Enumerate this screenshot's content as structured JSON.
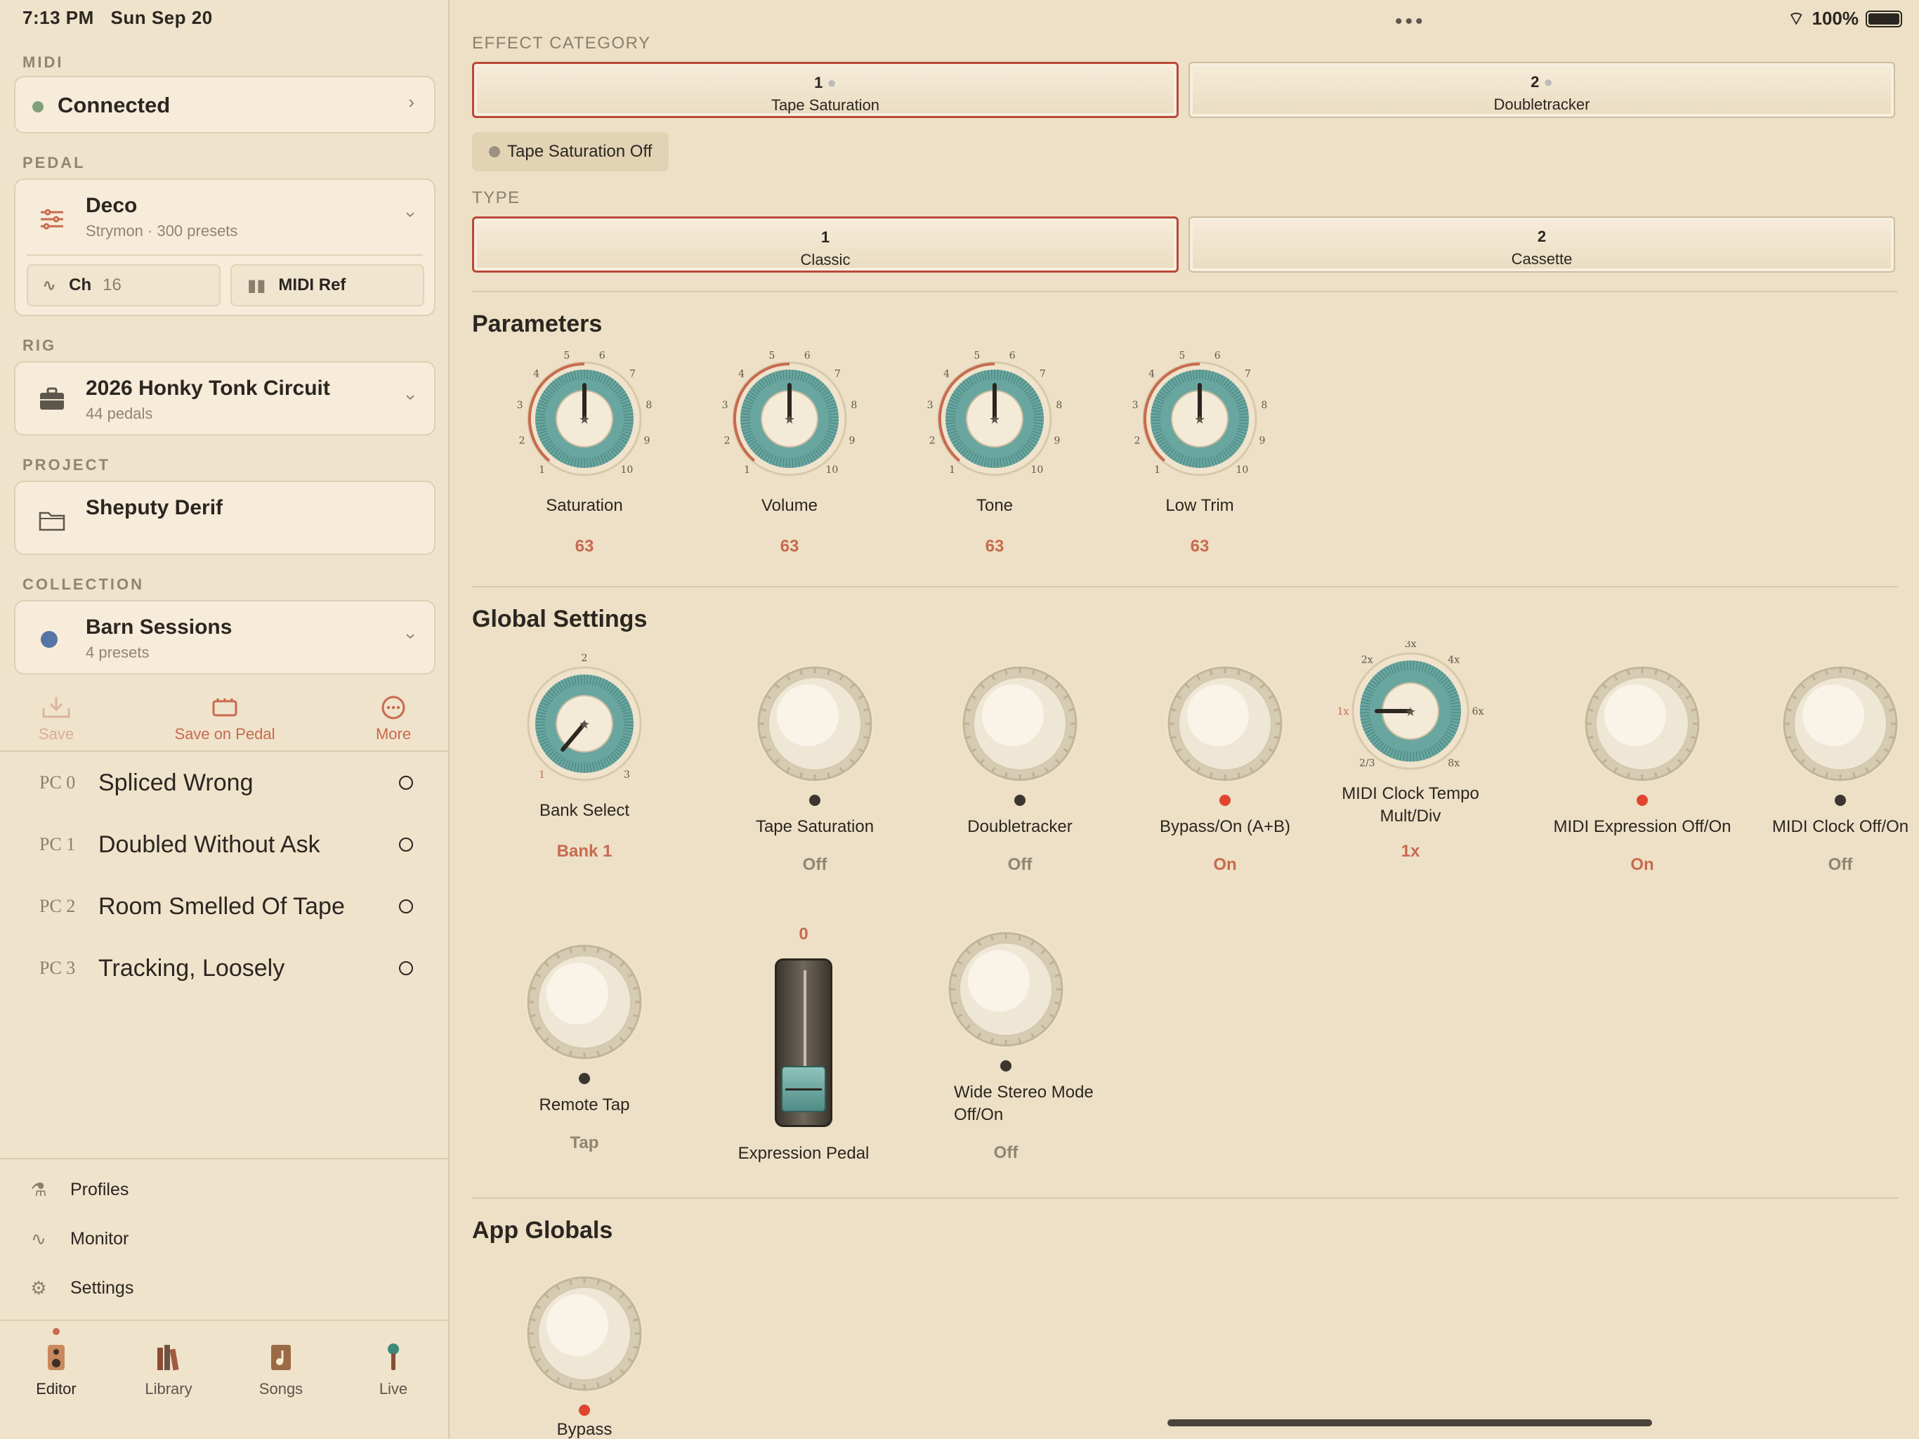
{
  "status": {
    "time": "7:13 PM",
    "date": "Sun Sep 20",
    "battery": "100%"
  },
  "sidebar": {
    "midi_label": "MIDI",
    "midi_status": "Connected",
    "pedal_label": "PEDAL",
    "pedal_name": "Deco",
    "pedal_sub": "Strymon · 300 presets",
    "channel_label": "Ch",
    "channel_value": "16",
    "midi_ref": "MIDI Ref",
    "rig_label": "RIG",
    "rig_name": "2026 Honky Tonk Circuit",
    "rig_sub": "44 pedals",
    "project_label": "PROJECT",
    "project_name": "Sheputy Derif",
    "collection_label": "COLLECTION",
    "collection_name": "Barn Sessions",
    "collection_sub": "4 presets",
    "actions": {
      "save": "Save",
      "save_on_pedal": "Save on Pedal",
      "more": "More"
    },
    "presets": [
      {
        "pc": "PC 0",
        "name": "Spliced Wrong"
      },
      {
        "pc": "PC 1",
        "name": "Doubled Without Ask"
      },
      {
        "pc": "PC 2",
        "name": "Room Smelled Of Tape"
      },
      {
        "pc": "PC 3",
        "name": "Tracking, Loosely"
      }
    ],
    "footer": {
      "profiles": "Profiles",
      "monitor": "Monitor",
      "settings": "Settings"
    },
    "tabs": {
      "editor": "Editor",
      "library": "Library",
      "songs": "Songs",
      "live": "Live"
    }
  },
  "main": {
    "effect_category_label": "EFFECT CATEGORY",
    "categories": [
      {
        "num": "1",
        "label": "Tape Saturation"
      },
      {
        "num": "2",
        "label": "Doubletracker"
      }
    ],
    "status_chip": "Tape Saturation Off",
    "type_label": "TYPE",
    "types": [
      {
        "num": "1",
        "label": "Classic"
      },
      {
        "num": "2",
        "label": "Cassette"
      }
    ],
    "parameters_title": "Parameters",
    "parameters": [
      {
        "label": "Saturation",
        "value": "63"
      },
      {
        "label": "Volume",
        "value": "63"
      },
      {
        "label": "Tone",
        "value": "63"
      },
      {
        "label": "Low Trim",
        "value": "63"
      }
    ],
    "global_title": "Global Settings",
    "bank_select": {
      "label": "Bank Select",
      "value": "Bank 1"
    },
    "switches": [
      {
        "label": "Tape Saturation",
        "value": "Off"
      },
      {
        "label": "Doubletracker",
        "value": "Off"
      },
      {
        "label": "Bypass/On (A+B)",
        "value": "On"
      },
      {
        "label": "MIDI Expression Off/On",
        "value": "On"
      },
      {
        "label": "MIDI Clock Off/On",
        "value": "Off"
      }
    ],
    "midi_clock": {
      "label": "MIDI Clock Tempo Mult/Div",
      "value": "1x"
    },
    "remote_tap": {
      "label": "Remote Tap",
      "value": "Tap"
    },
    "expression": {
      "label": "Expression Pedal",
      "value": "0"
    },
    "wide_stereo": {
      "label": "Wide Stereo Mode Off/On",
      "value": "Off"
    },
    "app_globals_title": "App Globals",
    "bypass": {
      "label": "Bypass"
    }
  },
  "colors": {
    "accent": "#c86a4e",
    "teal": "#6aa6a0",
    "background": "#ede0c6"
  }
}
